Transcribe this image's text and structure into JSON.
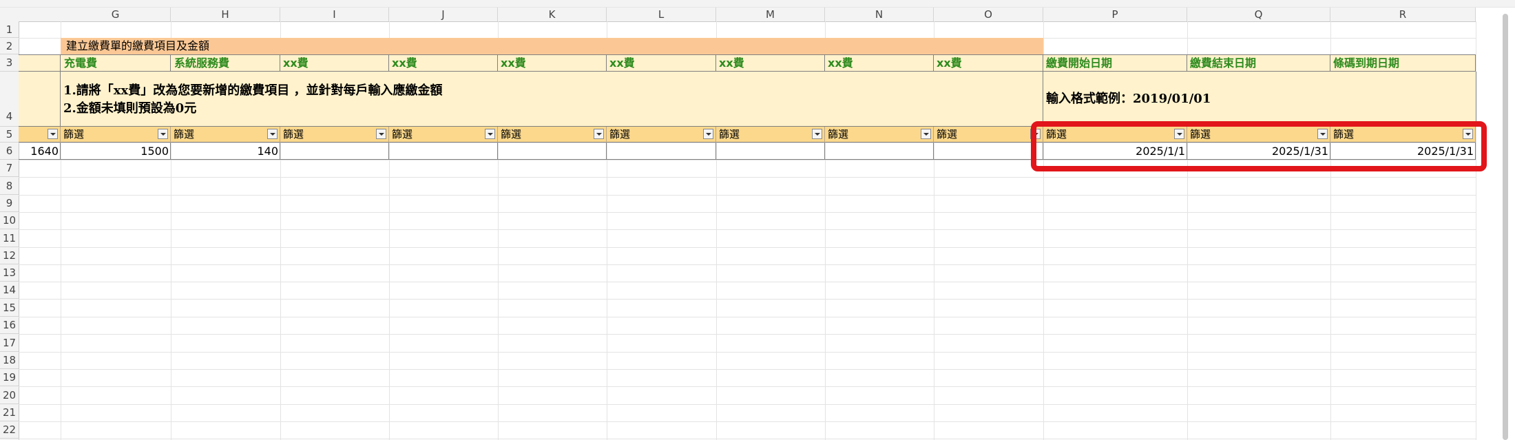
{
  "columns": [
    "G",
    "H",
    "I",
    "J",
    "K",
    "L",
    "M",
    "N",
    "O",
    "P",
    "Q",
    "R"
  ],
  "rows": [
    "1",
    "2",
    "3",
    "4",
    "5",
    "6",
    "7",
    "8",
    "9",
    "10",
    "11",
    "12",
    "13",
    "14",
    "15",
    "16",
    "17",
    "18",
    "19",
    "20",
    "21",
    "22"
  ],
  "sheet": {
    "title": "建立繳費單的繳費項目及金額",
    "headers": [
      "充電費",
      "系統服務費",
      "xx費",
      "xx費",
      "xx費",
      "xx費",
      "xx費",
      "xx費",
      "xx費",
      "繳費開始日期",
      "繳費結束日期",
      "條碼到期日期"
    ],
    "instruction_line1": "1.請將「xx費」改為您要新增的繳費項目 ，並針對每戶輸入應繳金額",
    "instruction_line2": "2.金額未填則預設為0元",
    "date_format_hint": "輸入格式範例：2019/01/01",
    "filter_label": "篩選",
    "row6": {
      "f": "1640",
      "g": "1500",
      "h": "140",
      "p": "2025/1/1",
      "q": "2025/1/31",
      "r": "2025/1/31"
    }
  },
  "colors": {
    "title_fill": "#fbc895",
    "header_fill": "#fff2cc",
    "filter_fill": "#fbd88c",
    "header_text": "#2e8b1e",
    "highlight": "#e1151a"
  }
}
